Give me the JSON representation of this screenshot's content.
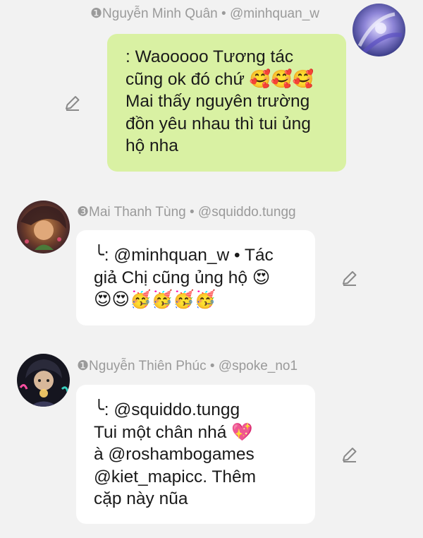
{
  "messages": [
    {
      "sender": "❶Nguyễn Minh Quân • @minhquan_w",
      "lines": [
        ": Waooooo Tương tác",
        "cũng ok đó chứ 🥰🥰🥰",
        "Mai thấy nguyên trường",
        "đồn yêu nhau thì tui ủng",
        "hộ nha"
      ]
    },
    {
      "sender": "❸Mai Thanh Tùng • @squiddo.tungg",
      "lines": [
        "╰: @minhquan_w • Tác",
        "giả Chị cũng ủng hộ 😍",
        "😍😍🥳🥳🥳🥳"
      ]
    },
    {
      "sender": "❶Nguyễn Thiên Phúc • @spoke_no1",
      "lines": [
        "╰: @squiddo.tungg",
        "Tui một chân nhá 💖",
        "à @roshambogames",
        "@kiet_mapicc. Thêm",
        "cặp này nũa"
      ]
    }
  ],
  "icons": {
    "edit": "pencil-edit-icon"
  },
  "colors": {
    "background": "#f2f2f2",
    "own_bubble": "#d9f1a3",
    "other_bubble": "#ffffff",
    "meta_text": "#9a9a9a"
  }
}
